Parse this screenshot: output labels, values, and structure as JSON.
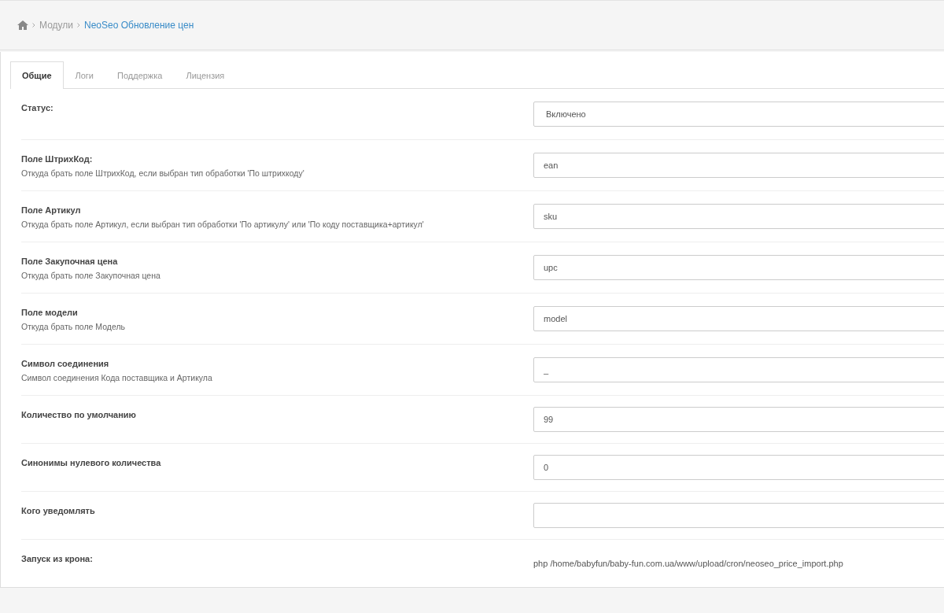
{
  "breadcrumb": [
    {
      "label": "Модули",
      "current": false
    },
    {
      "label": "NeoSeo Обновление цен",
      "current": true
    }
  ],
  "tabs": [
    {
      "label": "Общие",
      "selected": true
    },
    {
      "label": "Логи",
      "selected": false
    },
    {
      "label": "Поддержка",
      "selected": false
    },
    {
      "label": "Лицензия",
      "selected": false
    }
  ],
  "settings": [
    {
      "kind": "select",
      "label": "Статус:",
      "value": "Включено"
    },
    {
      "kind": "input",
      "label": "Поле ШтрихКод:",
      "help": "Откуда брать поле ШтрихКод, если выбран тип обработки 'По штрихкоду'",
      "value": "ean"
    },
    {
      "kind": "input",
      "label": "Поле Артикул",
      "help": "Откуда брать поле Артикул, если выбран тип обработки 'По артикулу' или 'По коду поставщика+артикул'",
      "value": "sku"
    },
    {
      "kind": "input",
      "label": "Поле Закупочная цена",
      "help": "Откуда брать поле Закупочная цена",
      "value": "upc"
    },
    {
      "kind": "input",
      "label": "Поле модели",
      "help": "Откуда брать поле Модель",
      "value": "model"
    },
    {
      "kind": "input",
      "label": "Символ соединения",
      "help": "Символ соединения Кода поставщика и Артикула",
      "value": "_"
    },
    {
      "kind": "input",
      "label": "Количество по умолчанию",
      "value": "99"
    },
    {
      "kind": "input",
      "label": "Синонимы нулевого количества",
      "value": "0"
    },
    {
      "kind": "input",
      "label": "Кого уведомлять"
    },
    {
      "kind": "text",
      "label": "Запуск из крона:",
      "value": "php /home/babyfun/baby-fun.com.ua/www/upload/cron/neoseo_price_import.php"
    }
  ]
}
